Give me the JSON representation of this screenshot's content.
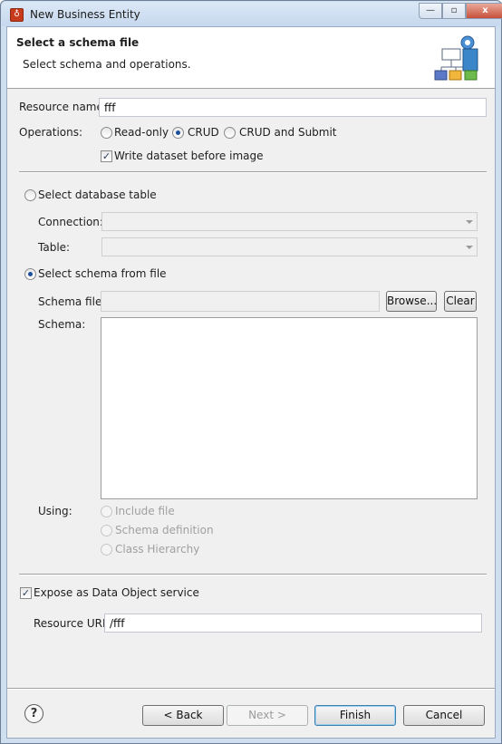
{
  "window": {
    "title": "New Business Entity",
    "app_icon_glyph": "♁",
    "controls": {
      "minimize": "—",
      "maximize": "▫",
      "close": "x"
    }
  },
  "banner": {
    "title": "Select a schema file",
    "description": "Select schema and operations."
  },
  "resource_name": {
    "label": "Resource name:",
    "value": "fff"
  },
  "operations": {
    "label": "Operations:",
    "options": [
      {
        "label": "Read-only",
        "selected": false
      },
      {
        "label": "CRUD",
        "selected": true
      },
      {
        "label": "CRUD and Submit",
        "selected": false
      }
    ],
    "write_dataset": {
      "label": "Write dataset before image",
      "checked": true
    }
  },
  "database_table": {
    "radio_label": "Select database table",
    "selected": false,
    "connection_label": "Connection:",
    "connection_value": "",
    "table_label": "Table:",
    "table_value": ""
  },
  "schema_from_file": {
    "radio_label": "Select schema from file",
    "selected": true,
    "schema_file_label": "Schema file:",
    "schema_file_value": "",
    "browse_label": "Browse...",
    "clear_label": "Clear",
    "schema_label": "Schema:"
  },
  "using": {
    "label": "Using:",
    "options": [
      {
        "label": "Include file"
      },
      {
        "label": "Schema definition"
      },
      {
        "label": "Class Hierarchy"
      }
    ]
  },
  "expose": {
    "label": "Expose as Data Object service",
    "checked": true,
    "resource_uri_label": "Resource URI:",
    "resource_uri_value": "/fff"
  },
  "footer": {
    "help_glyph": "?",
    "back_label": "< Back",
    "next_label": "Next >",
    "finish_label": "Finish",
    "cancel_label": "Cancel"
  },
  "colors": {
    "title_bar": "#cfdff0",
    "dialog_bg": "#f0f0f0",
    "radio_dot": "#1e4f9c",
    "close_button": "#c7503a"
  }
}
